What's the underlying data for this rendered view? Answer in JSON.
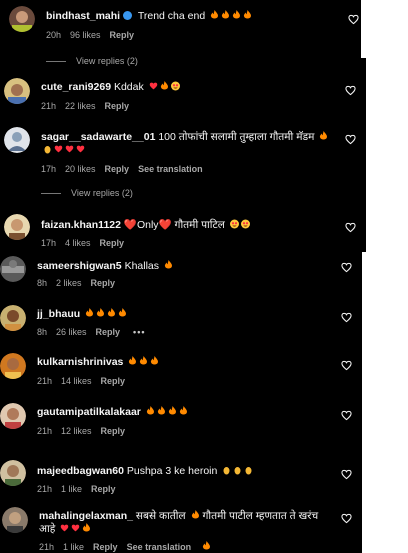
{
  "comments": [
    {
      "user": "bindhast_mahi",
      "verified": true,
      "text": "Trend cha end",
      "emoji": "🔥🔥🔥🔥",
      "time": "20h",
      "likes": "96 likes",
      "reply": "Reply",
      "extra": "",
      "view_replies": "View replies (2)"
    },
    {
      "user": "cute_rani9269",
      "verified": false,
      "text": "Kddak",
      "emoji": "❤️🔥😍",
      "time": "21h",
      "likes": "22 likes",
      "reply": "Reply",
      "extra": "",
      "view_replies": ""
    },
    {
      "user": "sagar__sadawarte__01",
      "verified": false,
      "text": "100 तोफांची सलामी तुम्हाला गौतमी मॅडम",
      "emoji": "🔥",
      "text2_emoji": "👏❤️❤️❤️",
      "time": "17h",
      "likes": "20 likes",
      "reply": "Reply",
      "extra": "See translation",
      "view_replies": "View replies (2)"
    },
    {
      "user": "faizan.khan1122",
      "verified": false,
      "text": "❤️Only❤️ गौतमी पाटिल",
      "emoji": "😍😍",
      "time": "17h",
      "likes": "4 likes",
      "reply": "Reply",
      "extra": "",
      "view_replies": ""
    },
    {
      "user": "sameershigwan5",
      "verified": false,
      "text": "Khallas",
      "emoji": "🔥",
      "time": "8h",
      "likes": "2 likes",
      "reply": "Reply",
      "extra": "",
      "view_replies": ""
    },
    {
      "user": "jj_bhauu",
      "verified": false,
      "text": "",
      "emoji": "🔥🔥🔥🔥",
      "time": "8h",
      "likes": "26 likes",
      "reply": "Reply",
      "extra": "•••",
      "view_replies": ""
    },
    {
      "user": "kulkarnishrinivas",
      "verified": false,
      "text": "",
      "emoji": "🔥🔥🔥",
      "time": "21h",
      "likes": "14 likes",
      "reply": "Reply",
      "extra": "",
      "view_replies": ""
    },
    {
      "user": "gautamipatilkalakaar",
      "verified": false,
      "text": "",
      "emoji": "🔥🔥🔥🔥",
      "time": "21h",
      "likes": "12 likes",
      "reply": "Reply",
      "extra": "",
      "view_replies": ""
    },
    {
      "user": "majeedbagwan60",
      "verified": false,
      "text": "Pushpa 3 ke heroin",
      "emoji": "👏👏👏",
      "time": "21h",
      "likes": "1 like",
      "reply": "Reply",
      "extra": "",
      "view_replies": ""
    },
    {
      "user": "mahalingelaxman_",
      "verified": false,
      "text": "सबसे कातील",
      "emoji": "🔥",
      "text_after": "गौतमी पाटील म्हणतात ते खरंच",
      "line2": "आहे",
      "text2_emoji": "❤️❤️🔥",
      "time": "21h",
      "likes": "1 like",
      "reply": "Reply",
      "extra": "See translation",
      "view_replies": ""
    }
  ],
  "colors": {
    "bg": "#000000",
    "text": "#f5f5f5",
    "meta": "#a8a8a8",
    "fire": "#ff8a00",
    "heart": "#ff3040",
    "verified": "#3897f0"
  }
}
